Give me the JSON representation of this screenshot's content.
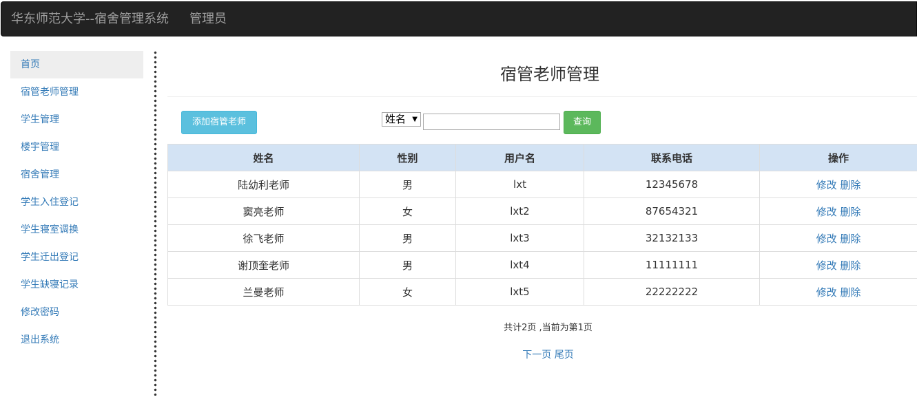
{
  "header": {
    "brand": "华东师范大学--宿舍管理系统",
    "role": "管理员"
  },
  "sidebar": {
    "items": [
      {
        "label": "首页",
        "active": true
      },
      {
        "label": "宿管老师管理"
      },
      {
        "label": "学生管理"
      },
      {
        "label": "楼宇管理"
      },
      {
        "label": "宿舍管理"
      },
      {
        "label": "学生入住登记"
      },
      {
        "label": "学生寝室调换"
      },
      {
        "label": "学生迁出登记"
      },
      {
        "label": "学生缺寝记录"
      },
      {
        "label": "修改密码"
      },
      {
        "label": "退出系统"
      }
    ]
  },
  "main": {
    "title": "宿管老师管理",
    "add_button": "添加宿管老师",
    "search_field_selected": "姓名",
    "search_value": "",
    "query_button": "查询"
  },
  "table": {
    "headers": [
      "姓名",
      "性别",
      "用户名",
      "联系电话",
      "操作"
    ],
    "rows": [
      {
        "name": "陆幼利老师",
        "gender": "男",
        "username": "lxt",
        "phone": "12345678"
      },
      {
        "name": "窦亮老师",
        "gender": "女",
        "username": "lxt2",
        "phone": "87654321"
      },
      {
        "name": "徐飞老师",
        "gender": "男",
        "username": "lxt3",
        "phone": "32132133"
      },
      {
        "name": "谢顶奎老师",
        "gender": "男",
        "username": "lxt4",
        "phone": "11111111"
      },
      {
        "name": "兰曼老师",
        "gender": "女",
        "username": "lxt5",
        "phone": "22222222"
      }
    ],
    "edit_label": "修改",
    "delete_label": "删除"
  },
  "pagination": {
    "info": "共计2页 ,当前为第1页",
    "next": "下一页",
    "last": "尾页"
  },
  "colors": {
    "navbar": "#222222",
    "link": "#337ab7",
    "info_button": "#5bc0de",
    "success_button": "#5cb85c",
    "table_header": "#d3e3f4"
  }
}
